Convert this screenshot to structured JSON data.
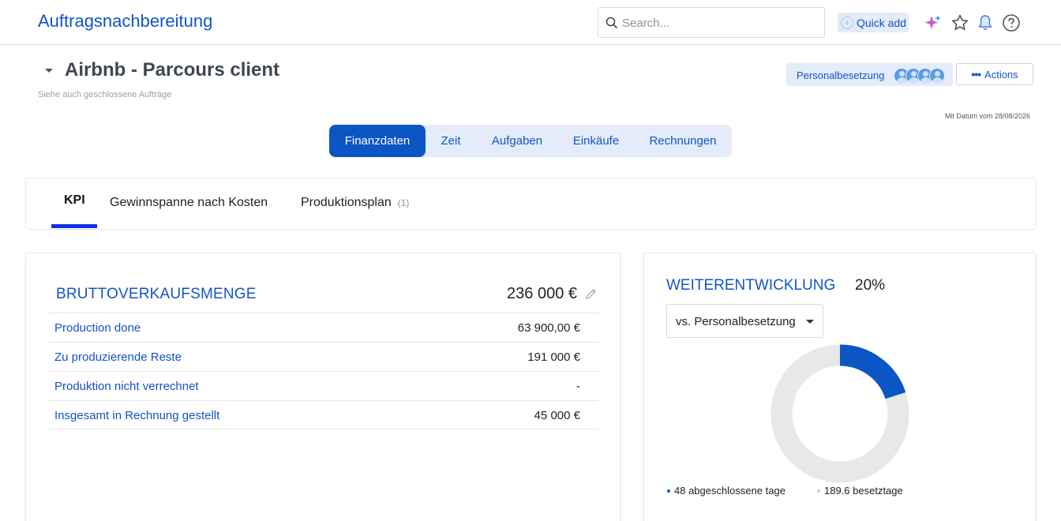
{
  "app": {
    "title": "Auftragsnachbereitung"
  },
  "search": {
    "placeholder": "Search..."
  },
  "quick_add": {
    "label": "Quick add"
  },
  "header": {
    "project_title": "Airbnb - Parcours client",
    "closed_orders_link": "Siehe auch geschlossene Aufträge",
    "staffing_label": "Personalbesetzung",
    "actions_label": "Actions",
    "date_note": "Mit Datum vom 28/08/2026"
  },
  "tabs": [
    {
      "label": "Finanzdaten",
      "active": true
    },
    {
      "label": "Zeit"
    },
    {
      "label": "Aufgaben"
    },
    {
      "label": "Einkäufe"
    },
    {
      "label": "Rechnungen"
    }
  ],
  "subtabs": [
    {
      "label": "KPI",
      "active": true
    },
    {
      "label": "Gewinnspanne nach Kosten"
    },
    {
      "label": "Produktionsplan",
      "count": "(1)"
    }
  ],
  "kpi": {
    "title": "BRUTTOVERKAUFSMENGE",
    "total": "236 000 €",
    "rows": [
      {
        "label": "Production done",
        "value": "63 900,00 €"
      },
      {
        "label": "Zu produzierende Reste",
        "value": "191 000 €"
      },
      {
        "label": "Produktion nicht verrechnet",
        "value": "-"
      },
      {
        "label": "Insgesamt in Rechnung gestellt",
        "value": "45 000 €"
      }
    ]
  },
  "development": {
    "title": "WEITERENTWICKLUNG",
    "percent": "20%",
    "percent_value": 0.2,
    "select_value": "vs. Personalbesetzung",
    "legend": [
      {
        "label": "48 abgeschlossene tage",
        "color": "#0c55c4"
      },
      {
        "label": "189.6 besetztage",
        "color": "#c8c8c8"
      }
    ]
  },
  "colors": {
    "accent": "#1454c4",
    "active_tab": "#0c55c4",
    "tab_bg": "#e3ecf8",
    "donut_track": "#e8e8e8"
  }
}
